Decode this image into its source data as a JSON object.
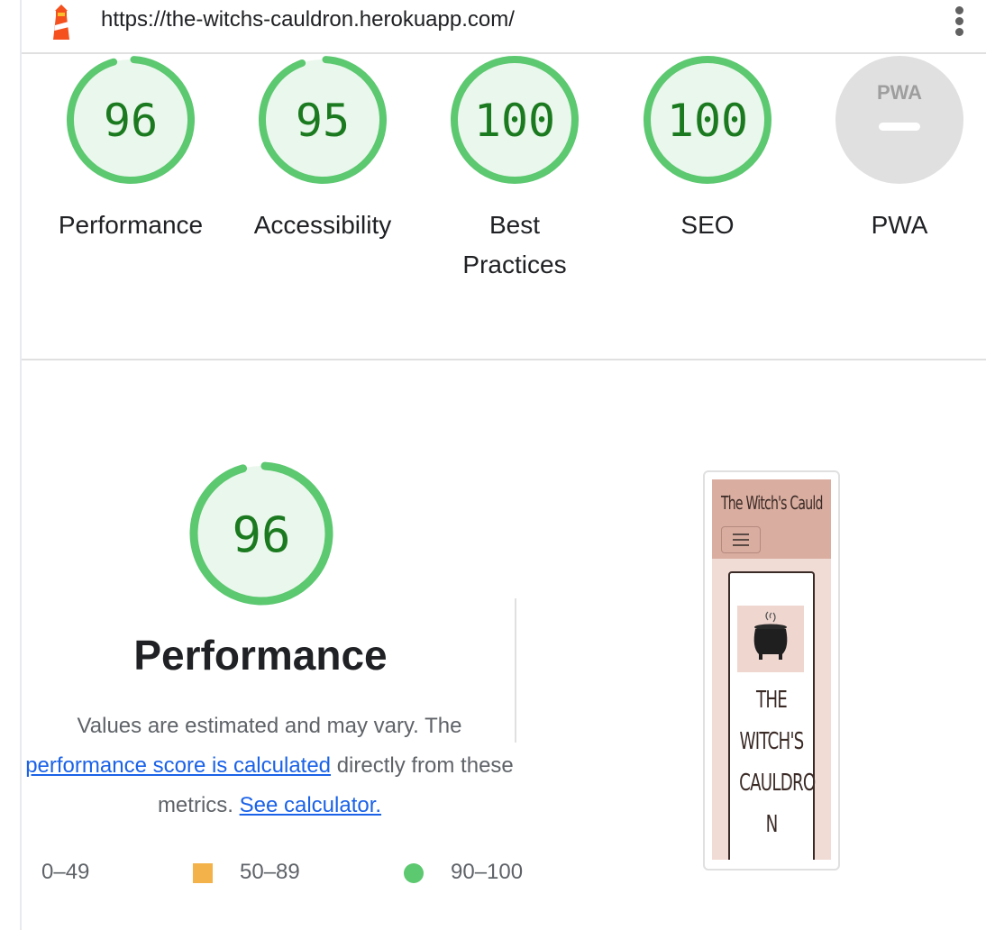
{
  "header": {
    "url": "https://the-witchs-cauldron.herokuapp.com/"
  },
  "gauges": [
    {
      "score": "96",
      "label": "Performance",
      "value": 96
    },
    {
      "score": "95",
      "label": "Accessibility",
      "value": 95
    },
    {
      "score": "100",
      "label": "Best Practices",
      "value": 100
    },
    {
      "score": "100",
      "label": "SEO",
      "value": 100
    },
    {
      "badge": "PWA",
      "label": "PWA"
    }
  ],
  "performance": {
    "score": "96",
    "value": 96,
    "title": "Performance",
    "desc_part1": "Values are estimated and may vary. The",
    "desc_link1": "performance score is calculated",
    "desc_part2": "directly from these metrics.",
    "desc_link2": "See calculator."
  },
  "legend": {
    "fail": "0–49",
    "average": "50–89",
    "pass": "90–100"
  },
  "thumbnail": {
    "site_title": "The Witch's Cauld",
    "card_text": "The Witch's Cauldron"
  },
  "colors": {
    "pass_ring": "#5cc870",
    "pass_text": "#1b7a1f",
    "pass_fill": "#eaf7ec",
    "average": "#f4b34a",
    "pwa_gray": "#e0e0e0",
    "link": "#1a62e8"
  },
  "icons": [
    "lighthouse-icon",
    "kebab-menu-icon",
    "hamburger-icon",
    "cauldron-icon"
  ]
}
